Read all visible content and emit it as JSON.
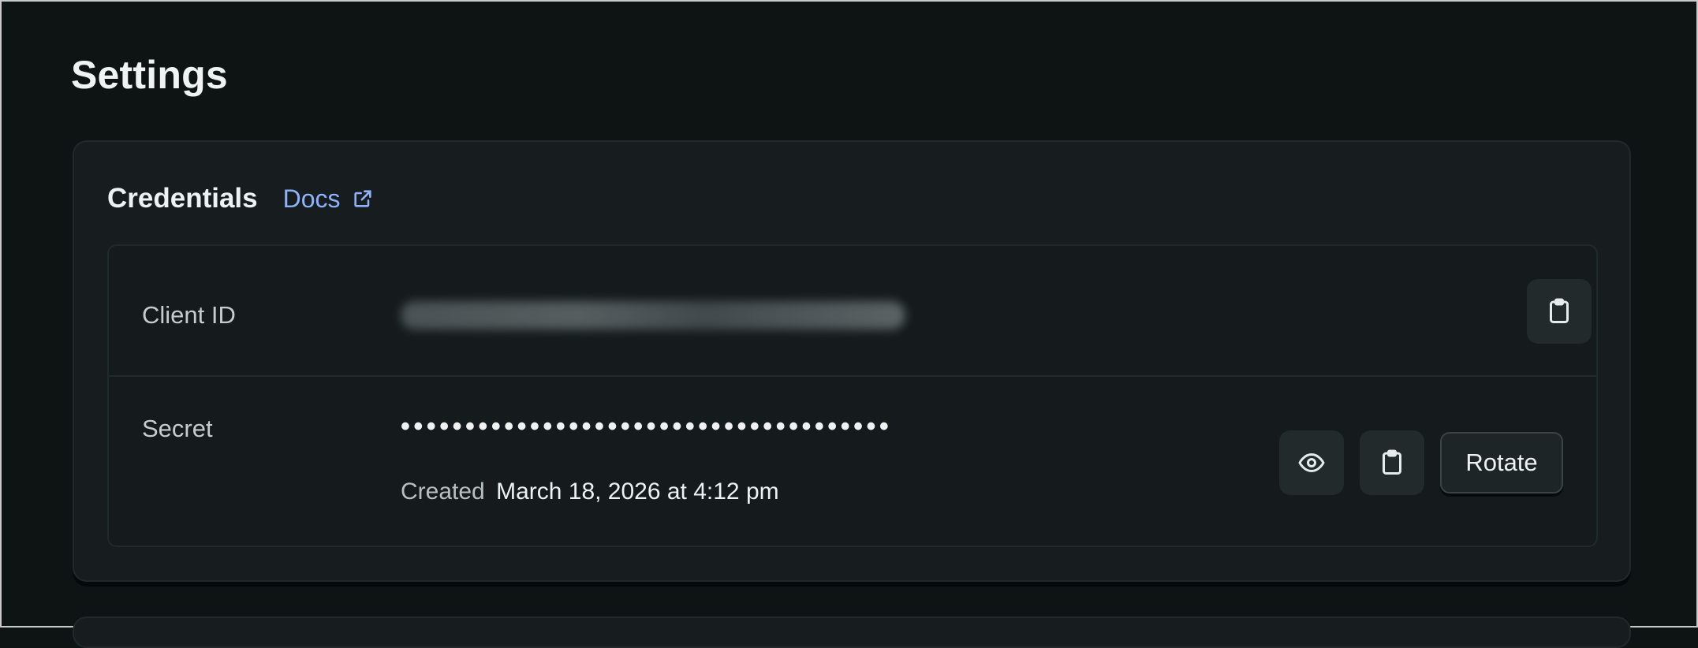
{
  "page": {
    "title": "Settings"
  },
  "credentials": {
    "title": "Credentials",
    "docs_label": "Docs",
    "client_id": {
      "label": "Client ID"
    },
    "secret": {
      "label": "Secret",
      "masked_value": "••••••••••••••••••••••••••••••••••••••",
      "created_label": "Created",
      "created_date": "March 18, 2026 at 4:12 pm",
      "rotate_label": "Rotate"
    }
  },
  "colors": {
    "background": "#0e1314",
    "card": "#171d1f",
    "link": "#8fb2ff"
  },
  "icons": [
    "external-link-icon",
    "clipboard-icon",
    "eye-icon"
  ]
}
